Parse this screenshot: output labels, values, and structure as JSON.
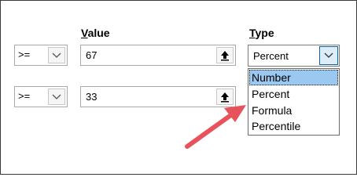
{
  "headers": {
    "value": {
      "accel": "V",
      "rest": "alue"
    },
    "type": {
      "accel": "T",
      "rest": "ype"
    }
  },
  "rows": [
    {
      "operator": ">=",
      "value": "67",
      "type": "Percent"
    },
    {
      "operator": ">=",
      "value": "33"
    }
  ],
  "type_dropdown": {
    "options": [
      "Number",
      "Percent",
      "Formula",
      "Percentile"
    ],
    "highlighted": "Number"
  },
  "colors": {
    "selection": "#9ac8f1",
    "accent_border": "#0b63a8",
    "annotation_arrow": "#e8525b"
  },
  "icons": {
    "operator_dropdown": "chevron-down-icon",
    "range_picker": "collapse-dialog-up-arrow-icon",
    "annotation": "red-arrow-annotation"
  }
}
